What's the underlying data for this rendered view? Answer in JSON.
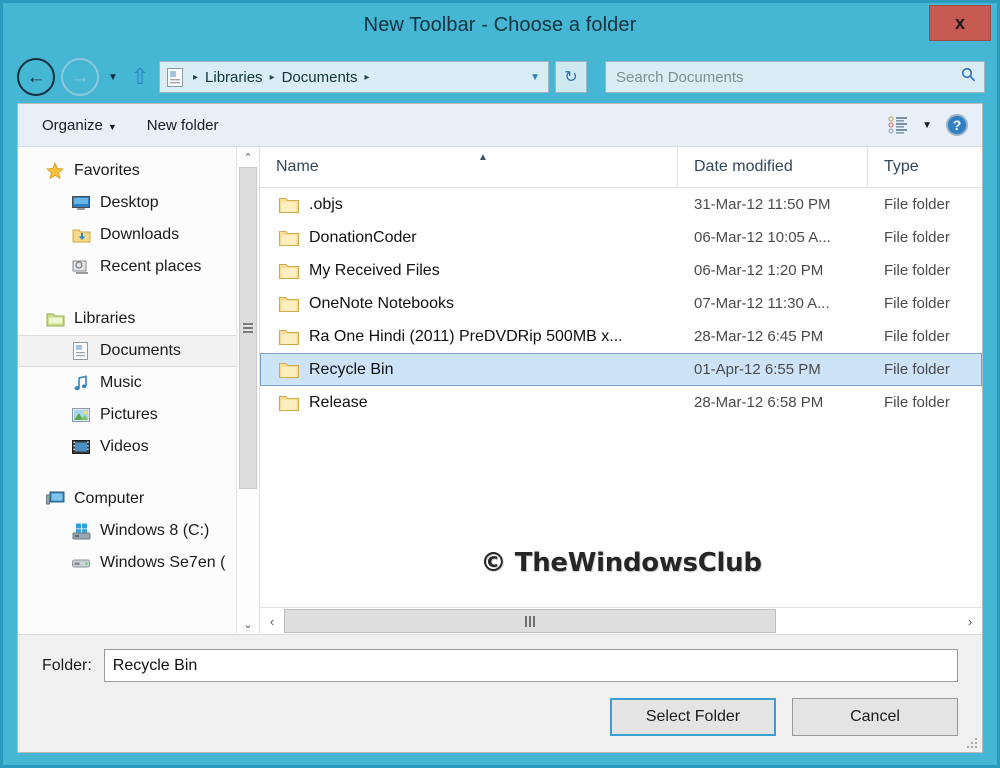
{
  "window": {
    "title": "New Toolbar - Choose a folder",
    "close_label": "x",
    "accent_color": "#45b6d4",
    "close_color": "#c75b54"
  },
  "nav": {
    "back_icon": "←",
    "forward_icon": "→",
    "recent_icon": "▼",
    "up_icon": "⇧",
    "refresh_icon": "↻",
    "address_dropdown_icon": "▼",
    "breadcrumb": [
      "Libraries",
      "Documents"
    ],
    "breadcrumb_separator": "▸"
  },
  "search": {
    "placeholder": "Search Documents",
    "icon": "search-icon"
  },
  "toolbar": {
    "organize_label": "Organize",
    "organize_caret": "▼",
    "new_folder_label": "New folder",
    "view_caret": "▼",
    "help_label": "?"
  },
  "sidebar": {
    "groups": [
      {
        "header": {
          "label": "Favorites",
          "icon": "star-icon"
        },
        "items": [
          {
            "label": "Desktop",
            "icon": "desktop-icon"
          },
          {
            "label": "Downloads",
            "icon": "downloads-icon"
          },
          {
            "label": "Recent places",
            "icon": "recent-places-icon"
          }
        ]
      },
      {
        "header": {
          "label": "Libraries",
          "icon": "libraries-icon"
        },
        "items": [
          {
            "label": "Documents",
            "icon": "documents-icon",
            "selected": true
          },
          {
            "label": "Music",
            "icon": "music-icon"
          },
          {
            "label": "Pictures",
            "icon": "pictures-icon"
          },
          {
            "label": "Videos",
            "icon": "videos-icon"
          }
        ]
      },
      {
        "header": {
          "label": "Computer",
          "icon": "computer-icon"
        },
        "items": [
          {
            "label": "Windows 8 (C:)",
            "icon": "windows-drive-icon"
          },
          {
            "label": "Windows Se7en (",
            "icon": "drive-icon"
          }
        ]
      }
    ],
    "scroll_up_icon": "⌃",
    "scroll_down_icon": "⌄"
  },
  "file_list": {
    "columns": [
      "Name",
      "Date modified",
      "Type"
    ],
    "sort_indicator": "▲",
    "rows": [
      {
        "name": ".objs",
        "date": "31-Mar-12 11:50 PM",
        "type": "File folder"
      },
      {
        "name": "DonationCoder",
        "date": "06-Mar-12 10:05 A...",
        "type": "File folder"
      },
      {
        "name": "My Received Files",
        "date": "06-Mar-12 1:20 PM",
        "type": "File folder"
      },
      {
        "name": "OneNote Notebooks",
        "date": "07-Mar-12 11:30 A...",
        "type": "File folder"
      },
      {
        "name": "Ra One Hindi (2011) PreDVDRip 500MB x...",
        "date": "28-Mar-12 6:45 PM",
        "type": "File folder"
      },
      {
        "name": "Recycle Bin",
        "date": "01-Apr-12 6:55 PM",
        "type": "File folder",
        "selected": true
      },
      {
        "name": "Release",
        "date": "28-Mar-12 6:58 PM",
        "type": "File folder"
      }
    ],
    "watermark": "© TheWindowsClub",
    "scroll_left_icon": "‹",
    "scroll_right_icon": "›"
  },
  "footer": {
    "folder_label": "Folder:",
    "folder_value": "Recycle Bin",
    "select_label": "Select Folder",
    "cancel_label": "Cancel"
  }
}
